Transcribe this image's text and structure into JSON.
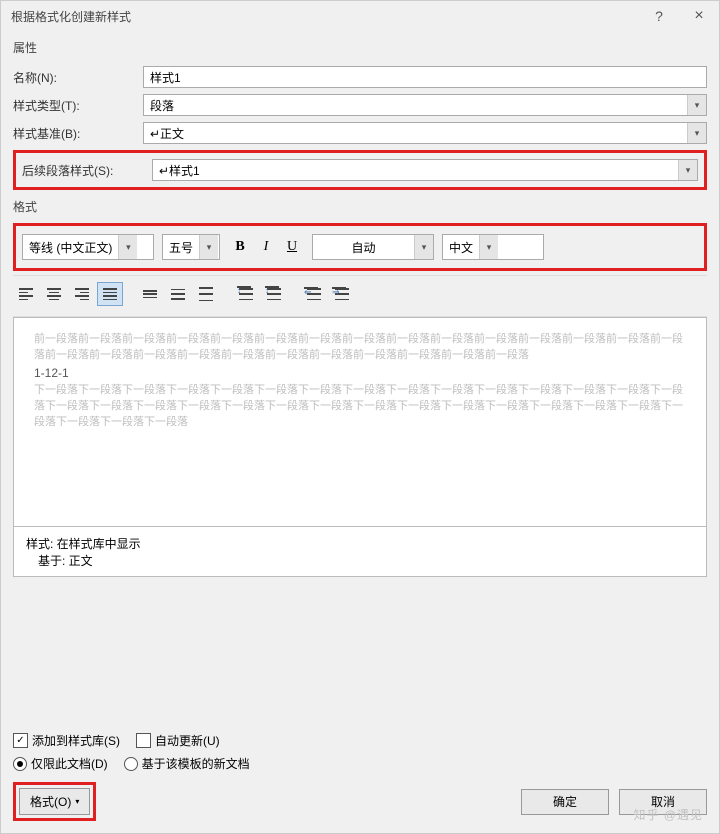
{
  "titlebar": {
    "title": "根据格式化创建新样式",
    "help": "?",
    "close": "×"
  },
  "groups": {
    "properties": "属性",
    "format": "格式"
  },
  "properties": {
    "name_label": "名称(N):",
    "name_value": "样式1",
    "type_label": "样式类型(T):",
    "type_value": "段落",
    "based_label": "样式基准(B):",
    "based_value": "↵正文",
    "following_label": "后续段落样式(S):",
    "following_value": "↵样式1"
  },
  "format_toolbar": {
    "font": "等线 (中文正文)",
    "size": "五号",
    "bold": "B",
    "italic": "I",
    "underline": "U",
    "color": "自动",
    "script": "中文"
  },
  "preview": {
    "before": "前一段落前一段落前一段落前一段落前一段落前一段落前一段落前一段落前一段落前一段落前一段落前一段落前一段落前一段落前一段落前一段落前一段落前一段落前一段落前一段落前一段落前一段落前一段落前一段落前一段落前一段落",
    "sample": "1-12-1",
    "after": "下一段落下一段落下一段落下一段落下一段落下一段落下一段落下一段落下一段落下一段落下一段落下一段落下一段落下一段落下一段落下一段落下一段落下一段落下一段落下一段落下一段落下一段落下一段落下一段落下一段落下一段落下一段落下一段落下一段落下一段落下一段落下一段落下一段落"
  },
  "description": {
    "line1": "样式: 在样式库中显示",
    "line2": "基于: 正文"
  },
  "options": {
    "add_to_gallery": "添加到样式库(S)",
    "auto_update": "自动更新(U)",
    "only_this_doc": "仅限此文档(D)",
    "new_docs": "基于该模板的新文档"
  },
  "buttons": {
    "format": "格式(O)",
    "ok": "确定",
    "cancel": "取消"
  },
  "watermark": "知乎 @遇见"
}
